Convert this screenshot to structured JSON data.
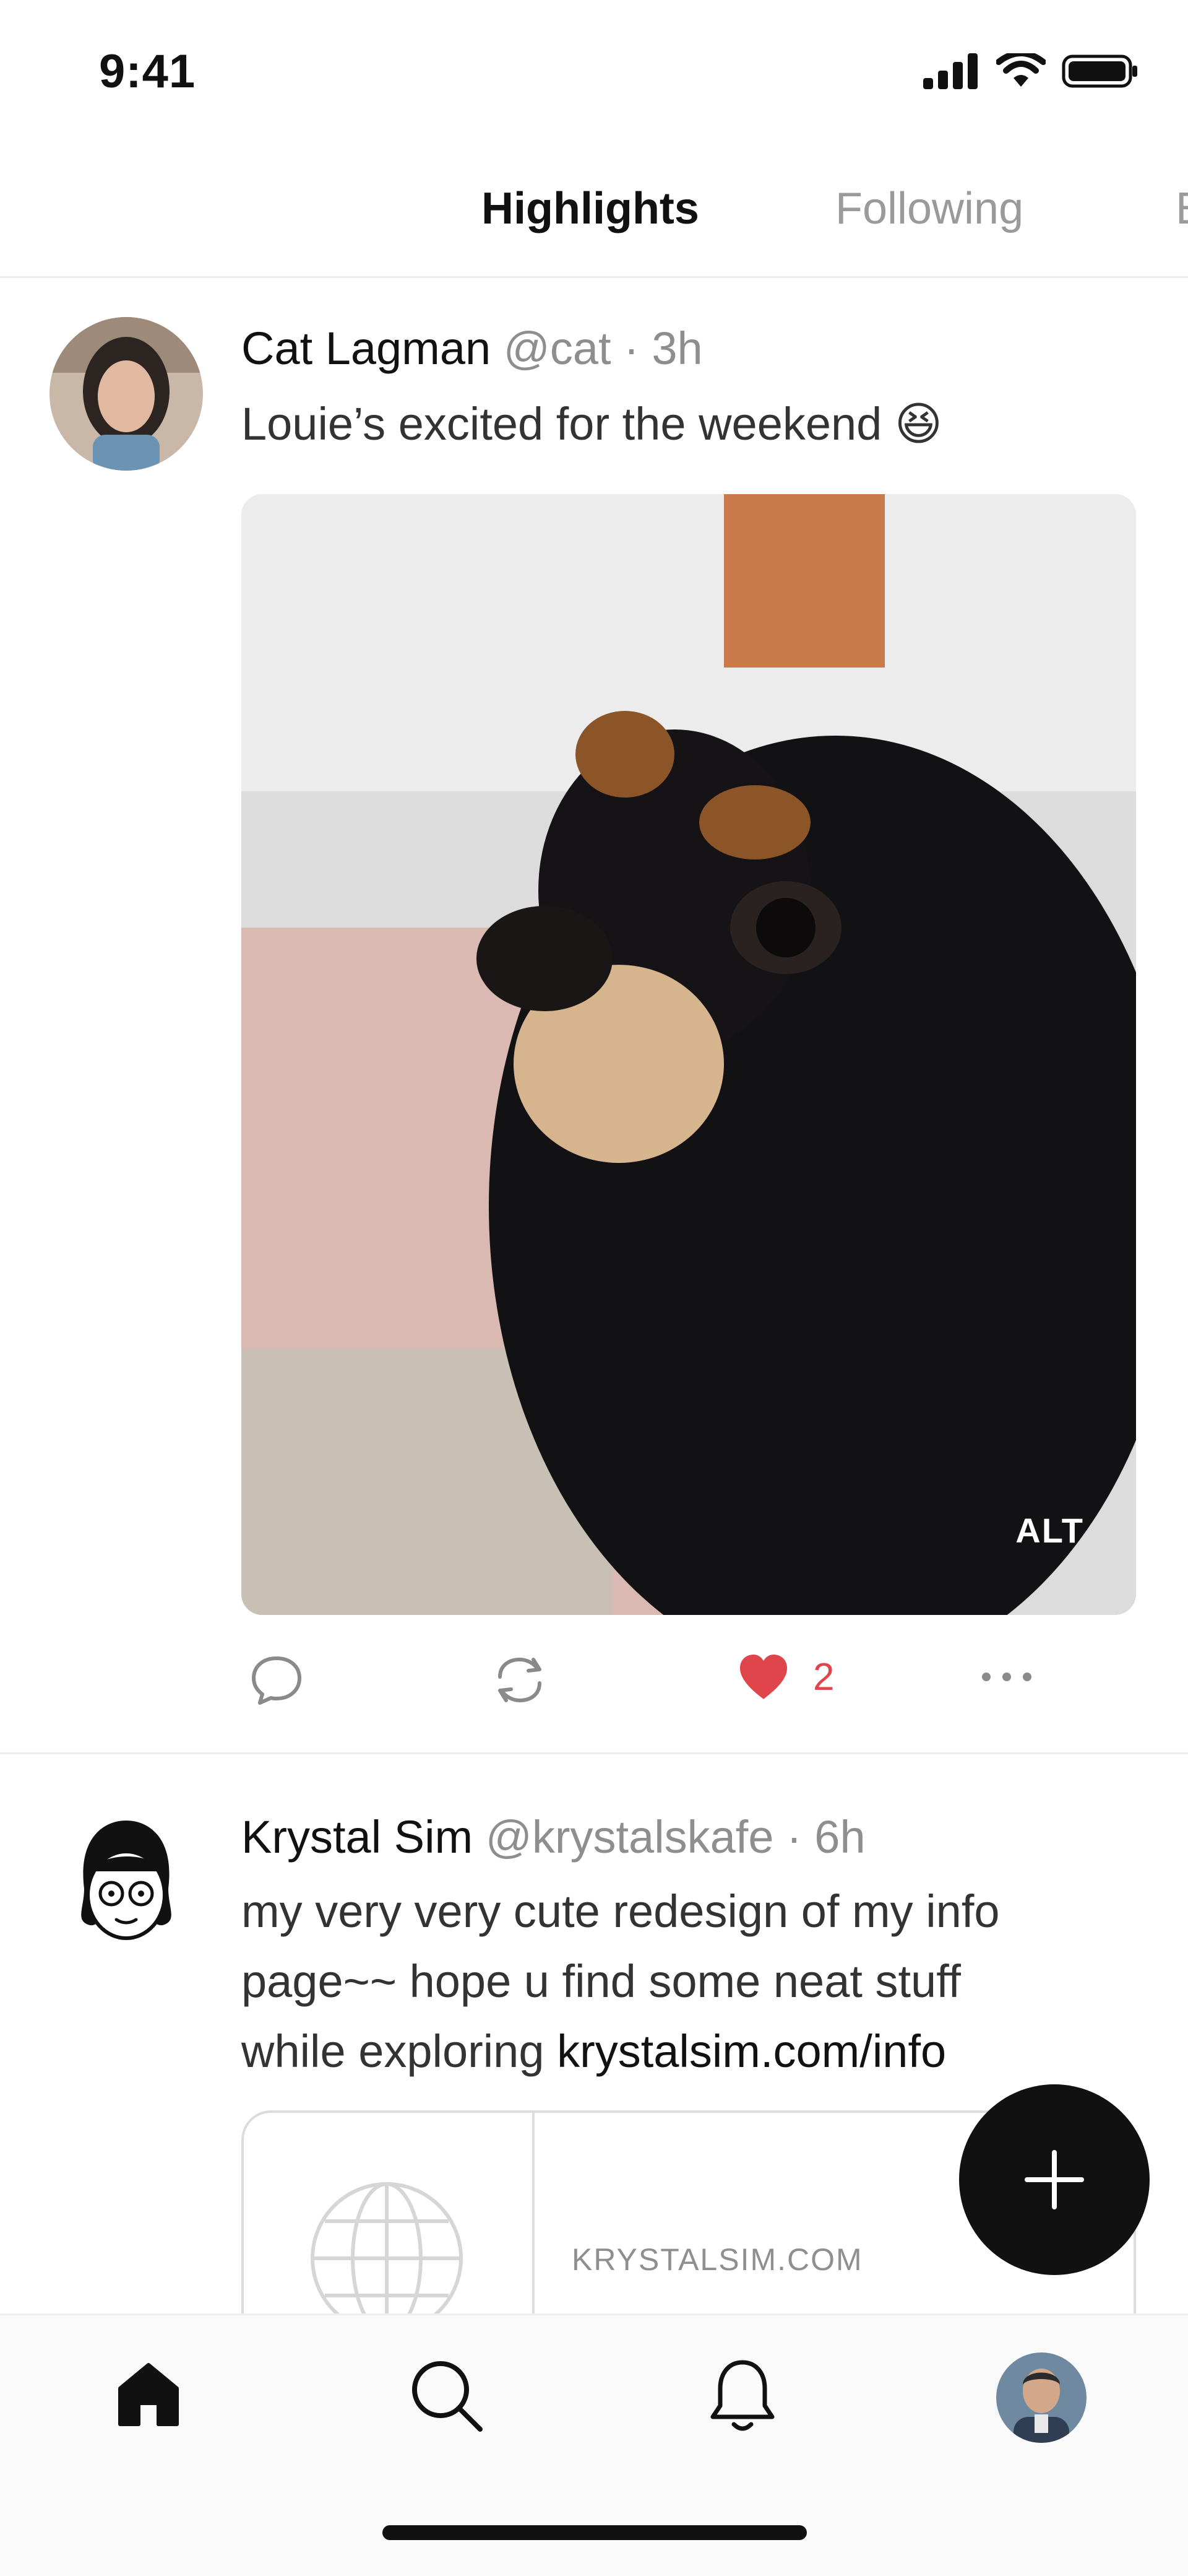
{
  "status_bar": {
    "time": "9:41"
  },
  "tabs": [
    {
      "label": "Highlights",
      "active": true
    },
    {
      "label": "Following",
      "active": false
    },
    {
      "label": "E",
      "active": false
    }
  ],
  "posts": [
    {
      "author": "Cat Lagman",
      "handle": "@cat",
      "time": "3h",
      "text": "Louie’s excited for the weekend 😆",
      "media_alt_label": "ALT",
      "likes": "2"
    },
    {
      "author": "Krystal Sim",
      "handle": "@krystalskafe",
      "time": "6h",
      "text_part1": "my very very cute redesign of my info page~~ hope u find some neat stuff while exploring ",
      "link_text": "krystalsim.com/info",
      "card_domain": "KRYSTALSIM.COM"
    }
  ],
  "colors": {
    "like": "#e0454b",
    "muted_text": "#8e8e8e",
    "fab_bg": "#111111"
  },
  "icons": {
    "status": [
      "cellular-signal-icon",
      "wifi-icon",
      "battery-icon"
    ],
    "actions": [
      "reply-icon",
      "repost-icon",
      "like-icon",
      "more-icon"
    ],
    "nav": [
      "home-icon",
      "search-icon",
      "notifications-icon",
      "profile-avatar"
    ]
  }
}
